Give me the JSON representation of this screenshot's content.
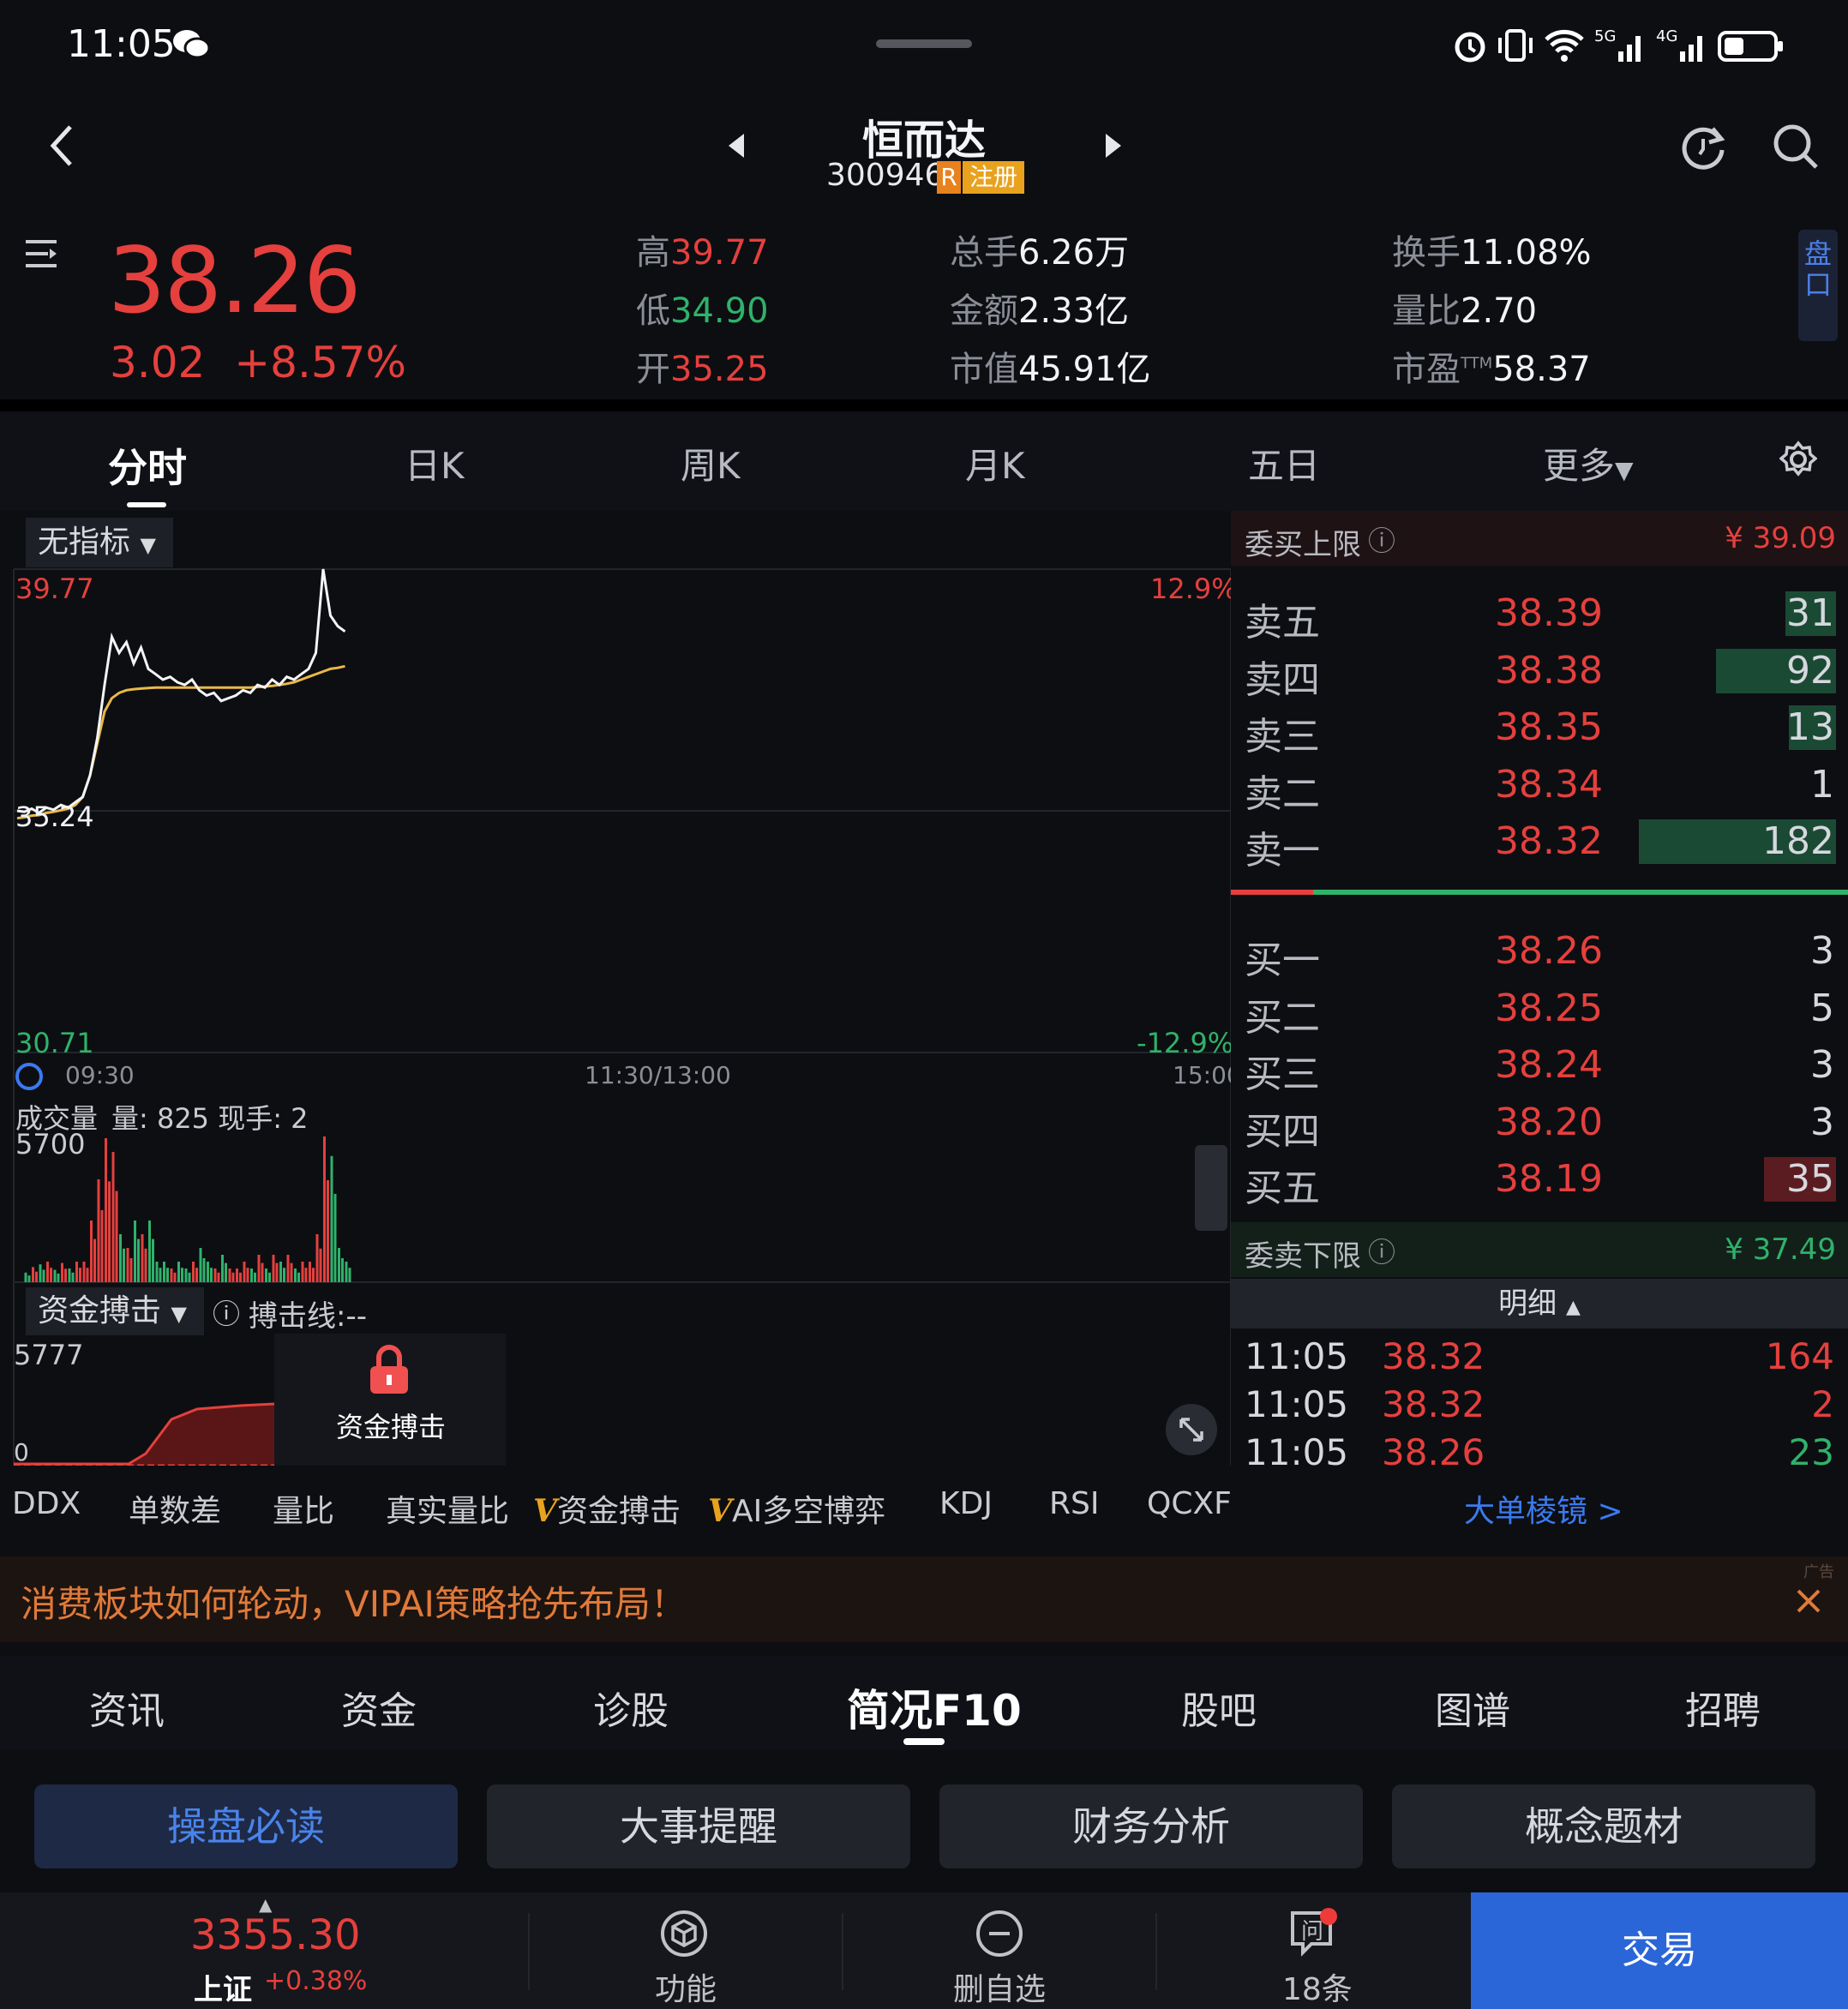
{
  "status": {
    "time": "11:05"
  },
  "header": {
    "title": "恒而达",
    "code": "300946",
    "badge_r": "R",
    "badge_reg": "注册"
  },
  "quote": {
    "price": "38.26",
    "change": "3.02",
    "change_pct": "+8.57%",
    "high_label": "高",
    "high": "39.77",
    "low_label": "低",
    "low": "34.90",
    "open_label": "开",
    "open": "35.25",
    "vol_label": "总手",
    "vol": "6.26万",
    "amount_label": "金额",
    "amount": "2.33亿",
    "mcap_label": "市值",
    "mcap": "45.91亿",
    "turnover_label": "换手",
    "turnover": "11.08%",
    "volratio_label": "量比",
    "volratio": "2.70",
    "pe_label": "市盈",
    "pe_sup": "TTM",
    "pe": "58.37",
    "pankou": "盘口"
  },
  "tabs": [
    "分时",
    "日K",
    "周K",
    "月K",
    "五日",
    "更多"
  ],
  "chart": {
    "indicator_select": "无指标",
    "price_top": "39.77",
    "price_mid": "35.24",
    "price_bottom": "30.71",
    "pct_top": "12.9%",
    "pct_bottom": "-12.9%",
    "time_start": "09:30",
    "time_mid": "11:30/13:00",
    "time_end": "15:00",
    "vol_title": "成交量",
    "vol_info": "量: 825  现手: 2",
    "vol_max": "5700",
    "fund_select": "资金搏击",
    "fund_line": "搏击线:--",
    "fund_max": "5777",
    "fund_zero": "0",
    "lock_label": "资金搏击"
  },
  "chart_data": {
    "type": "line",
    "ylim": [
      30.71,
      39.77
    ],
    "price_points": [
      35.24,
      35.22,
      35.28,
      35.2,
      35.3,
      35.26,
      35.35,
      35.3,
      35.4,
      35.5,
      35.9,
      36.6,
      37.6,
      38.5,
      38.2,
      38.4,
      38.0,
      38.3,
      37.9,
      37.8,
      37.7,
      37.75,
      37.65,
      37.6,
      37.7,
      37.5,
      37.4,
      37.45,
      37.3,
      37.35,
      37.4,
      37.5,
      37.45,
      37.6,
      37.55,
      37.7,
      37.6,
      37.75,
      37.7,
      37.8,
      37.9,
      38.2,
      39.77,
      38.9,
      38.7,
      38.6
    ],
    "avg_points": [
      35.1,
      35.12,
      35.15,
      35.16,
      35.2,
      35.22,
      35.25,
      35.28,
      35.35,
      35.5,
      35.9,
      36.5,
      37.1,
      37.35,
      37.45,
      37.5,
      37.52,
      37.53,
      37.54,
      37.55,
      37.55,
      37.55,
      37.55,
      37.55,
      37.55,
      37.55,
      37.55,
      37.55,
      37.55,
      37.55,
      37.55,
      37.55,
      37.55,
      37.56,
      37.57,
      37.58,
      37.6,
      37.62,
      37.65,
      37.7,
      37.75,
      37.8,
      37.85,
      37.9,
      37.92,
      37.95
    ]
  },
  "book": {
    "upper_label": "委买上限",
    "upper_value": "¥ 39.09",
    "lower_label": "委卖下限",
    "lower_value": "¥ 37.49",
    "sells": [
      {
        "label": "卖五",
        "price": "38.39",
        "vol": "31",
        "level": 0.05
      },
      {
        "label": "卖四",
        "price": "38.38",
        "vol": "92",
        "level": 0.5
      },
      {
        "label": "卖三",
        "price": "38.35",
        "vol": "13",
        "level": 0.03
      },
      {
        "label": "卖二",
        "price": "38.34",
        "vol": "1",
        "level": 0.0
      },
      {
        "label": "卖一",
        "price": "38.32",
        "vol": "182",
        "level": 1.0
      }
    ],
    "buys": [
      {
        "label": "买一",
        "price": "38.26",
        "vol": "3",
        "level": 0.0
      },
      {
        "label": "买二",
        "price": "38.25",
        "vol": "5",
        "level": 0.0
      },
      {
        "label": "买三",
        "price": "38.24",
        "vol": "3",
        "level": 0.0
      },
      {
        "label": "买四",
        "price": "38.20",
        "vol": "3",
        "level": 0.0
      },
      {
        "label": "买五",
        "price": "38.19",
        "vol": "35",
        "level": 0.19
      }
    ],
    "detail_label": "明细",
    "details": [
      {
        "time": "11:05",
        "price": "38.32",
        "vol": "164",
        "dir": "buy"
      },
      {
        "time": "11:05",
        "price": "38.32",
        "vol": "2",
        "dir": "buy"
      },
      {
        "time": "11:05",
        "price": "38.26",
        "vol": "23",
        "dir": "sell"
      }
    ]
  },
  "indicators": {
    "items": [
      "DDX",
      "单数差",
      "量比",
      "真实量比",
      "资金搏击",
      "AI多空博弈",
      "KDJ",
      "RSI",
      "QCXF"
    ],
    "v_mark": "V",
    "link": "大单棱镜 >"
  },
  "ad": {
    "text": "消费板块如何轮动，VIPAI策略抢先布局！",
    "tag": "广告"
  },
  "tabs2": [
    "资讯",
    "资金",
    "诊股",
    "简况F10",
    "股吧",
    "图谱",
    "招聘"
  ],
  "quick": [
    "操盘必读",
    "大事提醒",
    "财务分析",
    "概念题材"
  ],
  "bottom": {
    "index_value": "3355.30",
    "index_name": "上证",
    "index_pct": "+0.38%",
    "func": "功能",
    "remove": "删自选",
    "msgs": "18条",
    "trade": "交易"
  },
  "colors": {
    "up": "#e5403d",
    "down": "#2fb26b",
    "accent": "#2a66d8",
    "avg_line": "#e9b949"
  }
}
